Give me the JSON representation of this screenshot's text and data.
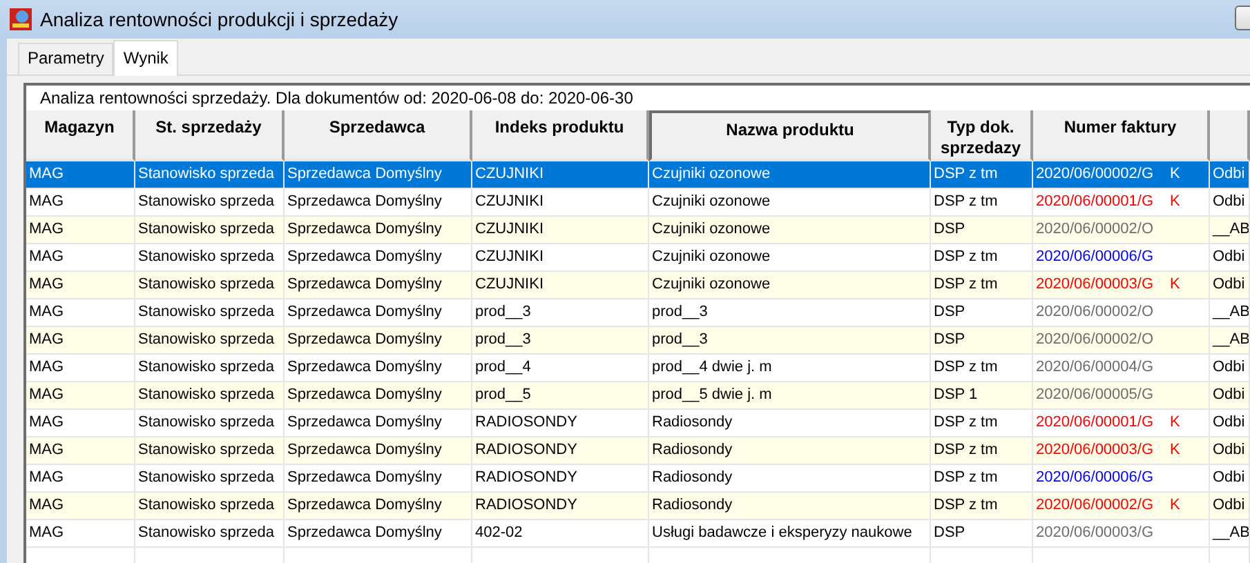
{
  "window": {
    "title": "Analiza rentowności produkcji i sprzedaży"
  },
  "tabs": [
    {
      "label": "Parametry",
      "selected": false
    },
    {
      "label": "Wynik",
      "selected": true
    }
  ],
  "report": {
    "caption": "Analiza rentowności sprzedaży. Dla dokumentów od: 2020-06-08 do: 2020-06-30",
    "columns": [
      {
        "label": "Magazyn",
        "sorted": false
      },
      {
        "label": "St. sprzedaży",
        "sorted": false
      },
      {
        "label": "Sprzedawca",
        "sorted": false
      },
      {
        "label": "Indeks produktu",
        "sorted": false
      },
      {
        "label": "Nazwa produktu",
        "sorted": true
      },
      {
        "label": "Typ dok. sprzedazy",
        "sorted": false
      },
      {
        "label": "Numer faktury",
        "sorted": false
      }
    ],
    "rows": [
      {
        "cells": [
          "MAG",
          "Stanowisko sprzeda",
          "Sprzedawca Domyślny",
          "CZUJNIKI",
          "Czujniki ozonowe",
          "DSP z tm"
        ],
        "invoice": "2020/06/00002/G",
        "flag": "K",
        "column_8": "Odbi",
        "selected": true
      },
      {
        "cells": [
          "MAG",
          "Stanowisko sprzeda",
          "Sprzedawca Domyślny",
          "CZUJNIKI",
          "Czujniki ozonowe",
          "DSP z tm"
        ],
        "invoice": "2020/06/00001/G",
        "color": "#ff0000",
        "flag": "K",
        "column_8": "Odbi",
        "selected": false
      },
      {
        "cells": [
          "MAG",
          "Stanowisko sprzeda",
          "Sprzedawca Domyślny",
          "CZUJNIKI",
          "Czujniki ozonowe",
          "DSP"
        ],
        "invoice": "2020/06/00002/O",
        "color": "#6d6d6d",
        "column_8": "__AB",
        "selected": false
      },
      {
        "cells": [
          "MAG",
          "Stanowisko sprzeda",
          "Sprzedawca Domyślny",
          "CZUJNIKI",
          "Czujniki ozonowe",
          "DSP z tm"
        ],
        "invoice": "2020/06/00006/G",
        "color": "#0000ff",
        "column_8": "Odbi",
        "selected": false
      },
      {
        "cells": [
          "MAG",
          "Stanowisko sprzeda",
          "Sprzedawca Domyślny",
          "CZUJNIKI",
          "Czujniki ozonowe",
          "DSP z tm"
        ],
        "invoice": "2020/06/00003/G",
        "color": "#ff0000",
        "flag": "K",
        "column_8": "Odbi",
        "selected": false
      },
      {
        "cells": [
          "MAG",
          "Stanowisko sprzeda",
          "Sprzedawca Domyślny",
          "prod__3",
          "prod__3",
          "DSP"
        ],
        "invoice": "2020/06/00002/O",
        "color": "#6d6d6d",
        "column_8": "__AB",
        "selected": false
      },
      {
        "cells": [
          "MAG",
          "Stanowisko sprzeda",
          "Sprzedawca Domyślny",
          "prod__3",
          "prod__3",
          "DSP"
        ],
        "invoice": "2020/06/00002/O",
        "color": "#6d6d6d",
        "column_8": "__AB",
        "selected": false
      },
      {
        "cells": [
          "MAG",
          "Stanowisko sprzeda",
          "Sprzedawca Domyślny",
          "prod__4",
          "prod__4 dwie j. m",
          "DSP z tm"
        ],
        "invoice": "2020/06/00004/G",
        "color": "#6d6d6d",
        "column_8": "Odbi",
        "selected": false
      },
      {
        "cells": [
          "MAG",
          "Stanowisko sprzeda",
          "Sprzedawca Domyślny",
          "prod__5",
          "prod__5 dwie j. m",
          "DSP 1"
        ],
        "invoice": "2020/06/00005/G",
        "color": "#6d6d6d",
        "column_8": "Odbi",
        "selected": false
      },
      {
        "cells": [
          "MAG",
          "Stanowisko sprzeda",
          "Sprzedawca Domyślny",
          "RADIOSONDY",
          "Radiosondy",
          "DSP z tm"
        ],
        "invoice": "2020/06/00001/G",
        "color": "#ff0000",
        "flag": "K",
        "column_8": "Odbi",
        "selected": false
      },
      {
        "cells": [
          "MAG",
          "Stanowisko sprzeda",
          "Sprzedawca Domyślny",
          "RADIOSONDY",
          "Radiosondy",
          "DSP z tm"
        ],
        "invoice": "2020/06/00003/G",
        "color": "#ff0000",
        "flag": "K",
        "column_8": "Odbi",
        "selected": false
      },
      {
        "cells": [
          "MAG",
          "Stanowisko sprzeda",
          "Sprzedawca Domyślny",
          "RADIOSONDY",
          "Radiosondy",
          "DSP z tm"
        ],
        "invoice": "2020/06/00006/G",
        "color": "#0000ff",
        "column_8": "Odbi",
        "selected": false
      },
      {
        "cells": [
          "MAG",
          "Stanowisko sprzeda",
          "Sprzedawca Domyślny",
          "RADIOSONDY",
          "Radiosondy",
          "DSP z tm"
        ],
        "invoice": "2020/06/00002/G",
        "color": "#ff0000",
        "flag": "K",
        "column_8": "Odbi",
        "selected": false
      },
      {
        "cells": [
          "MAG",
          "Stanowisko sprzeda",
          "Sprzedawca Domyślny",
          "402-02",
          "Usługi badawcze i eksperyzy naukowe",
          "DSP"
        ],
        "invoice": "2020/06/00003/G",
        "color": "#6d6d6d",
        "column_8": "__AB",
        "selected": false
      }
    ]
  }
}
